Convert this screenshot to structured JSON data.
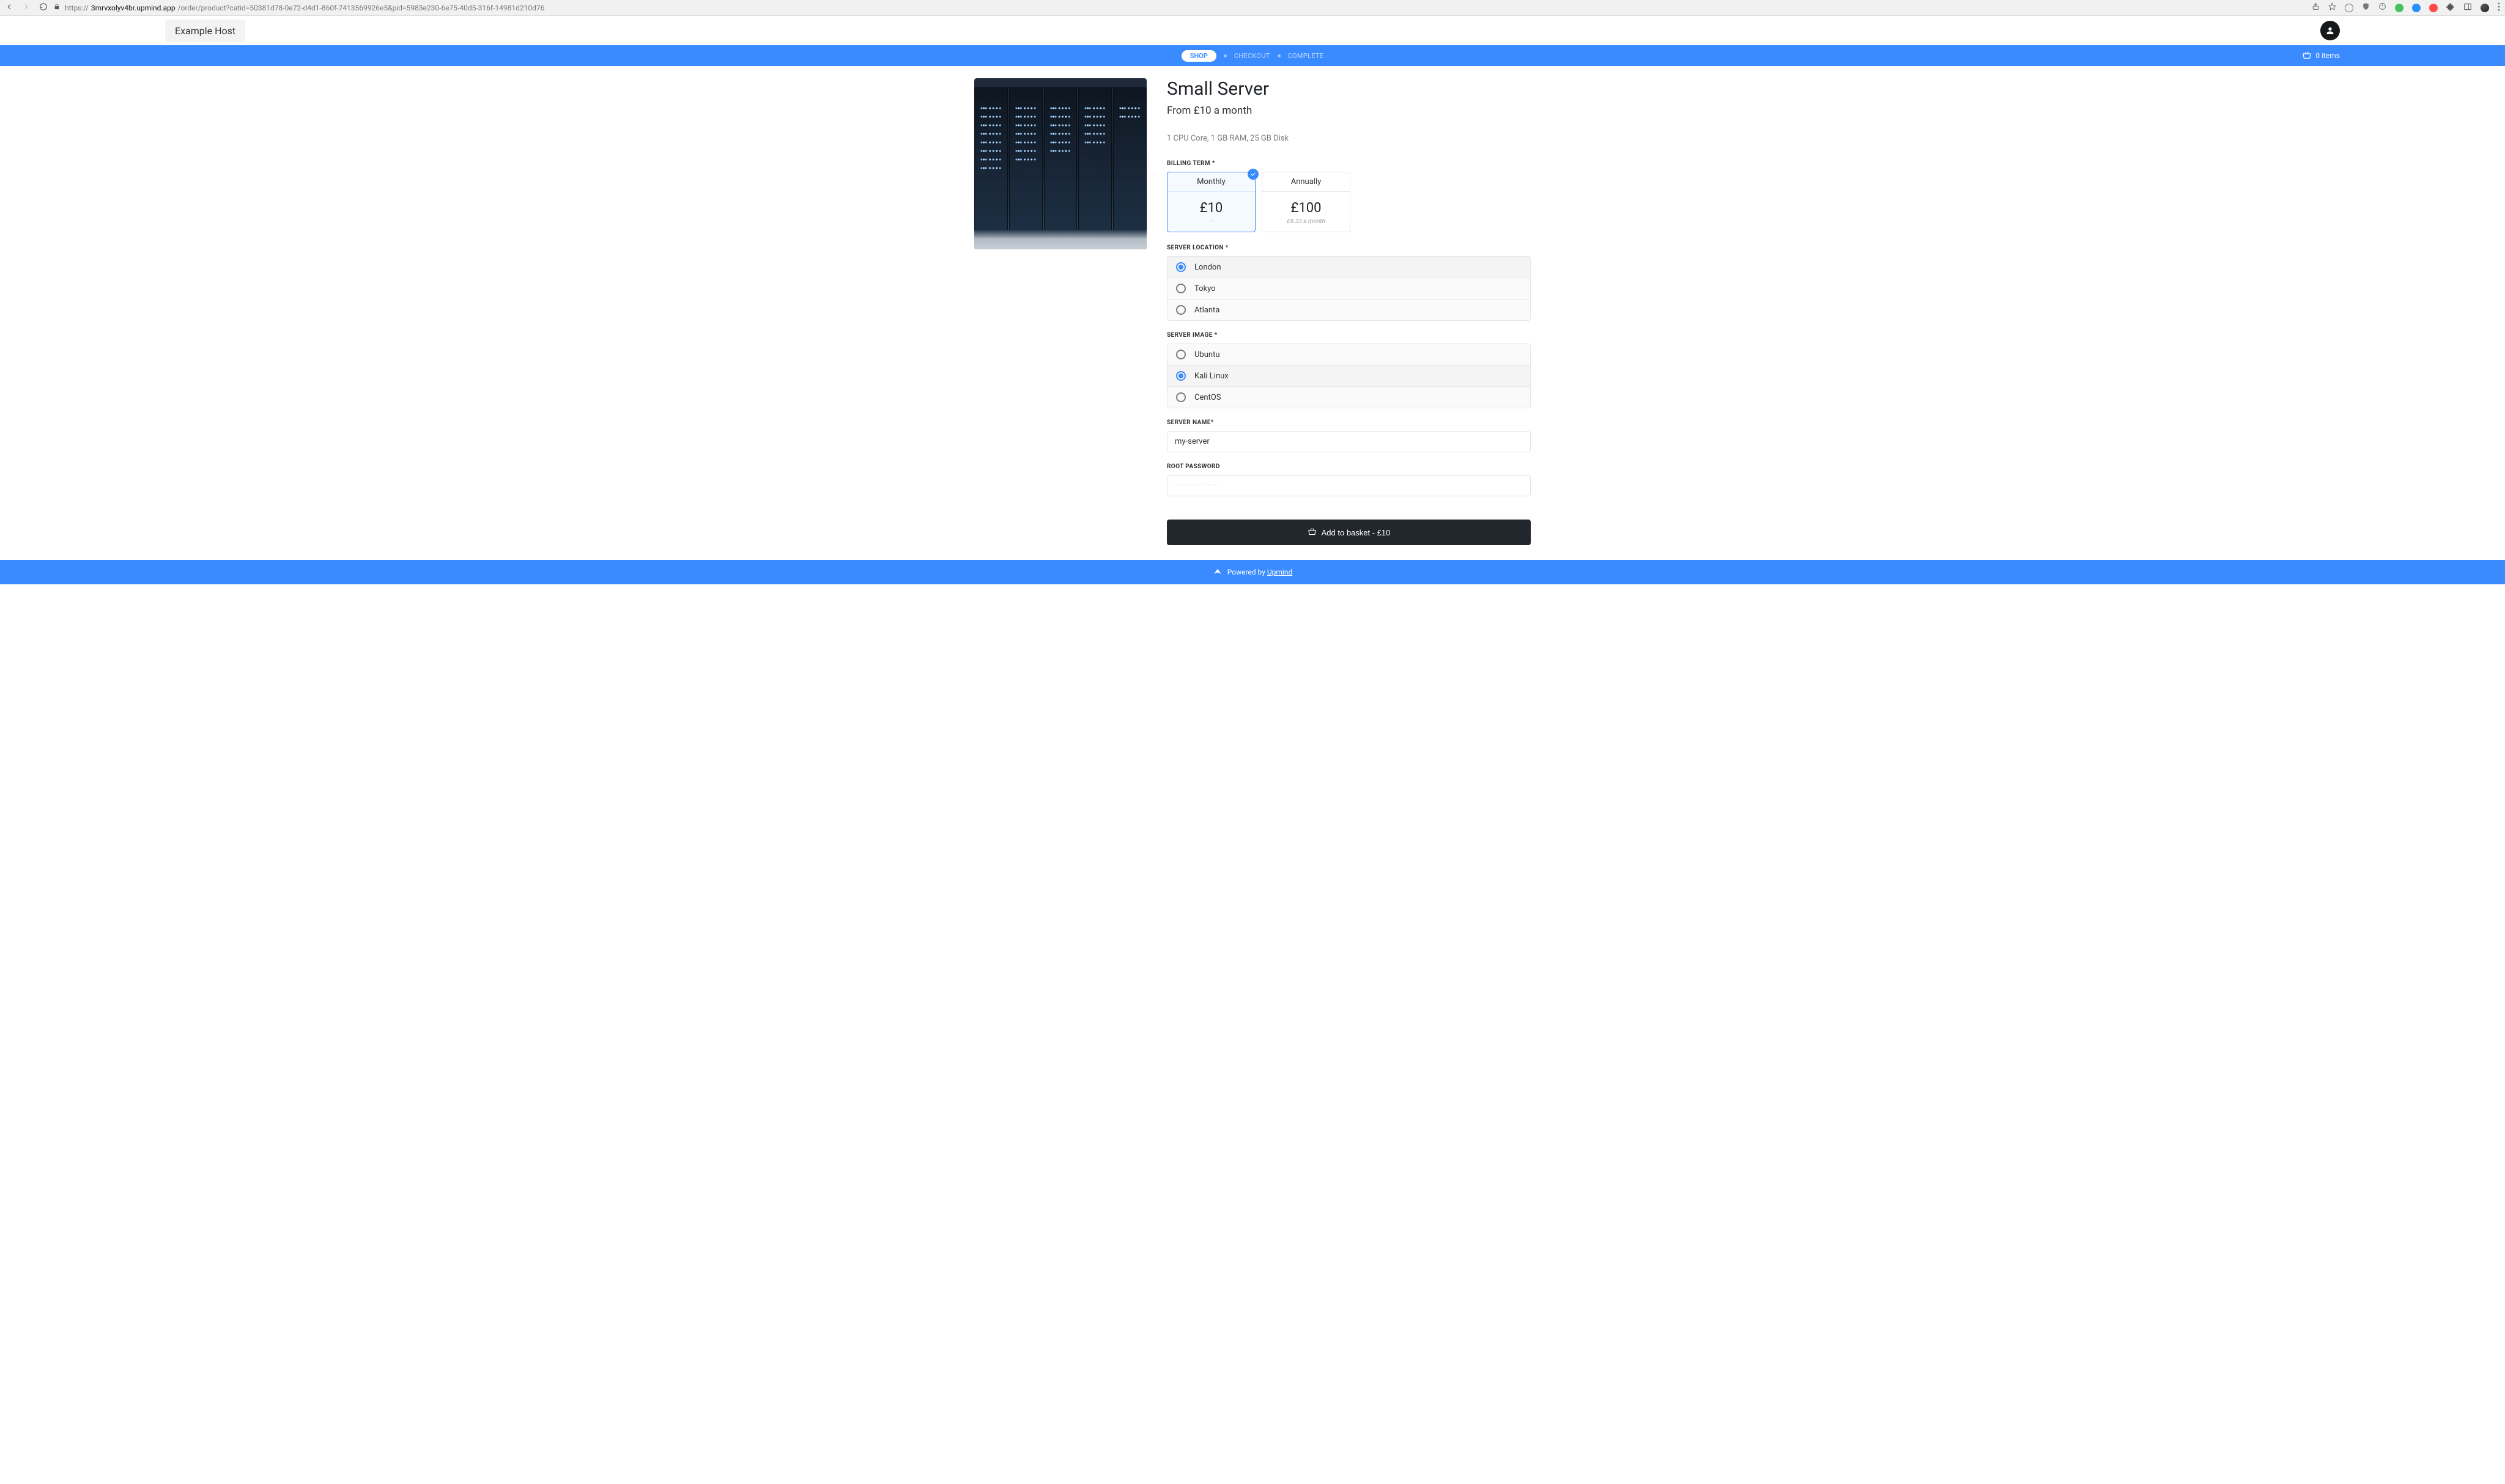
{
  "browser": {
    "url_prefix": "https://",
    "url_host": "3mrvxolyv4br.upmind.app",
    "url_path": "/order/product?catid=50381d78-0e72-d4d1-860f-7413569926e5&pid=5983e230-6e75-40d5-316f-14981d210d76"
  },
  "header": {
    "brand": "Example Host"
  },
  "progress": {
    "current": "SHOP",
    "steps": [
      "CHECKOUT",
      "COMPLETE"
    ]
  },
  "basket": {
    "label": "0 items"
  },
  "product": {
    "title": "Small Server",
    "subtitle": "From £10 a month",
    "specs": "1 CPU Core, 1 GB RAM, 25 GB Disk"
  },
  "billing": {
    "label": "BILLING TERM *",
    "selected_index": 0,
    "options": [
      {
        "name": "Monthly",
        "price": "£10",
        "sub": "–"
      },
      {
        "name": "Annually",
        "price": "£100",
        "sub": "£8.33 a month"
      }
    ]
  },
  "location": {
    "label": "SERVER LOCATION *",
    "selected_index": 0,
    "options": [
      "London",
      "Tokyo",
      "Atlanta"
    ]
  },
  "image": {
    "label": "SERVER IMAGE *",
    "selected_index": 1,
    "options": [
      "Ubuntu",
      "Kali Linux",
      "CentOS"
    ]
  },
  "server_name": {
    "label": "SERVER NAME*",
    "value": "my-server"
  },
  "root_password": {
    "label": "ROOT PASSWORD",
    "placeholder": "··············"
  },
  "cta": {
    "label": "Add to basket - £10"
  },
  "footer": {
    "prefix": "Powered by",
    "link": "Upmind"
  }
}
